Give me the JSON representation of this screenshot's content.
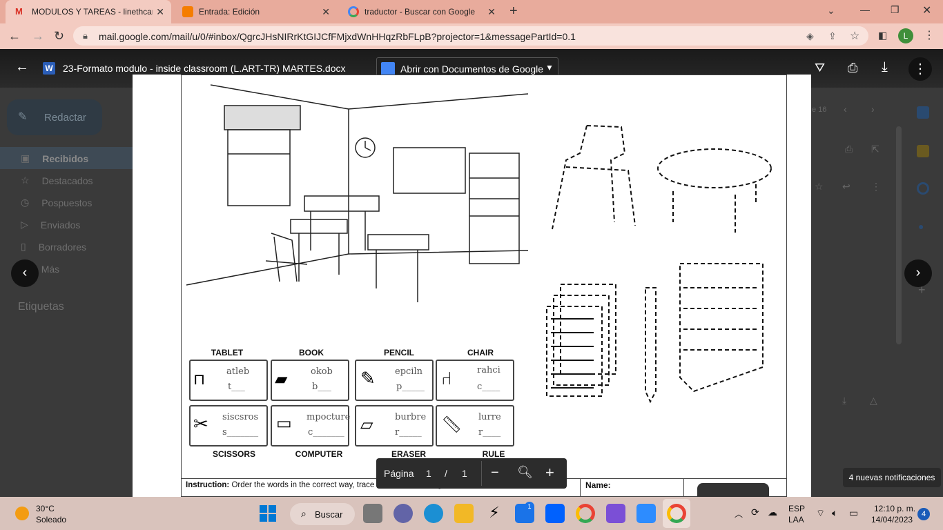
{
  "tabs": [
    {
      "label": "MODULOS Y TAREAS - linethcano",
      "icon": "gmail-icon"
    },
    {
      "label": "Entrada: Edición",
      "icon": "blogger-icon"
    },
    {
      "label": "traductor - Buscar con Google",
      "icon": "google-icon"
    }
  ],
  "browser": {
    "url": "mail.google.com/mail/u/0/#inbox/QgrcJHsNIRrKtGIJCfFMjxdWnHHqzRbFLpB?projector=1&messagePartId=0.1",
    "profile_initial": "L"
  },
  "gmail": {
    "compose": "Redactar",
    "nav": [
      "Recibidos",
      "Destacados",
      "Pospuestos",
      "Enviados",
      "Borradores",
      "Más"
    ],
    "labels": "Etiquetas",
    "pagecount": "e 16"
  },
  "viewer": {
    "filename": "23-Formato modulo - inside classroom (L.ART-TR) MARTES.docx",
    "open_with": "Abrir con Documentos de Google",
    "page_label": "Página",
    "page_current": "1",
    "page_sep": "/",
    "page_total": "1"
  },
  "worksheet": {
    "top_labels": [
      "TABLET",
      "BOOK",
      "PENCIL",
      "CHAIR"
    ],
    "row1": [
      {
        "scrambled": "atleb",
        "hint": "t___"
      },
      {
        "scrambled": "okob",
        "hint": "b___"
      },
      {
        "scrambled": "epciln",
        "hint": "p_____"
      },
      {
        "scrambled": "rahci",
        "hint": "c____"
      }
    ],
    "row2": [
      {
        "scrambled": "siscsros",
        "hint": "s_______"
      },
      {
        "scrambled": "mpocture",
        "hint": "c_______"
      },
      {
        "scrambled": "burbre",
        "hint": "r_____"
      },
      {
        "scrambled": "lurre",
        "hint": "r____"
      }
    ],
    "bottom_labels": [
      "SCISSORS",
      "COMPUTER",
      "ERASER",
      "RULE"
    ],
    "instruction_bold": "Instruction:",
    "instruction_text": "Order the words in the correct way, trace and color the things we find inside the classroom.",
    "name_label": "Name:"
  },
  "notification": "4 nuevas notificaciones",
  "taskbar": {
    "weather_temp": "30°C",
    "weather_desc": "Soleado",
    "search": "Buscar",
    "lang1": "ESP",
    "lang2": "LAA",
    "time": "12:10 p. m.",
    "date": "14/04/2023",
    "notif_count": "4",
    "mail_badge": "1"
  }
}
